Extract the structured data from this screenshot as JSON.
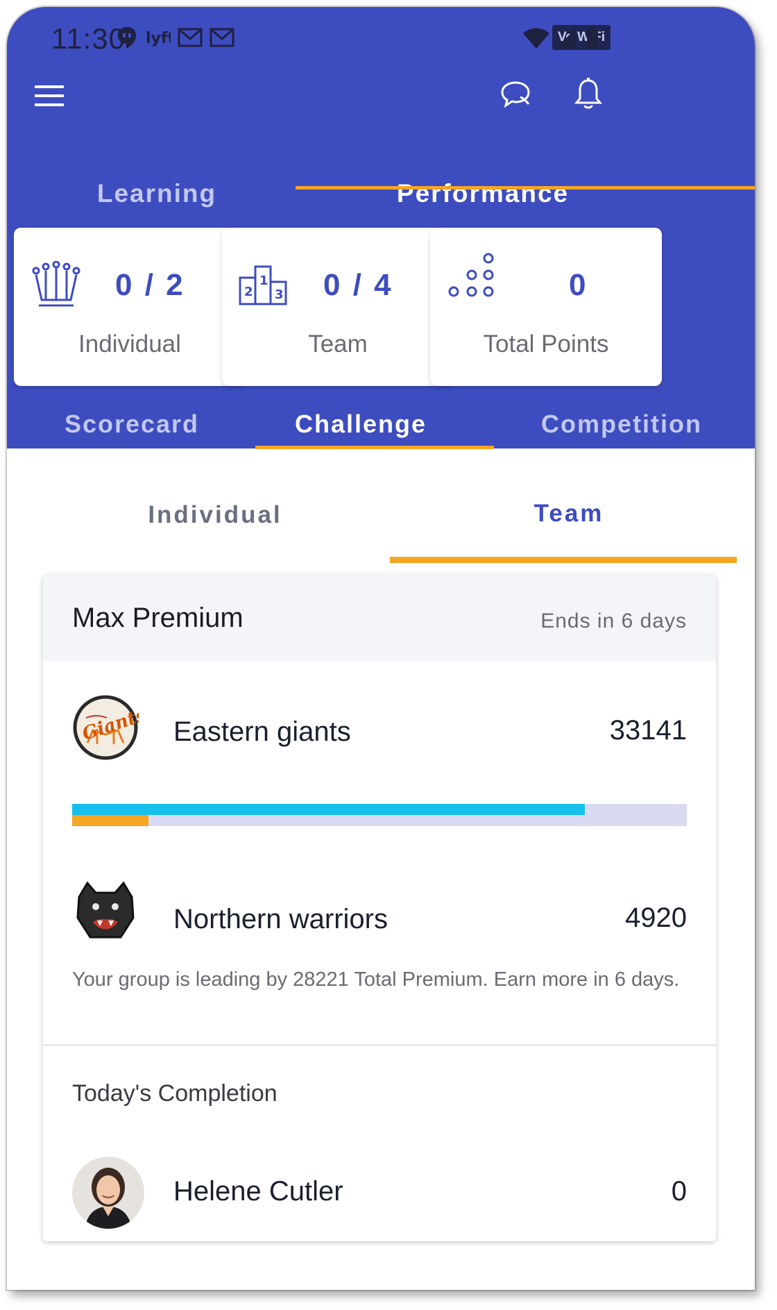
{
  "status_bar": {
    "time": "11:30",
    "vowifi": "Vo WiFi",
    "notification_icons": [
      "hangouts-icon",
      "lyft-icon",
      "mail-icon",
      "mail-icon"
    ],
    "system_icons": [
      "wifi-icon",
      "signal-icon",
      "battery-icon"
    ]
  },
  "app_bar": {
    "menu_icon": "menu-icon",
    "chat_icon": "chat-icon",
    "bell_icon": "bell-icon"
  },
  "top_tabs": [
    {
      "label": "Learning",
      "active": false
    },
    {
      "label": "Performance",
      "active": true
    }
  ],
  "stats": [
    {
      "value": "0 / 2",
      "label": "Individual",
      "icon": "crown-icon"
    },
    {
      "value": "0 / 4",
      "label": "Team",
      "icon": "podium-icon"
    },
    {
      "value": "0",
      "label": "Total Points",
      "icon": "dots-pyramid-icon"
    }
  ],
  "sub_tabs": [
    {
      "label": "Scorecard",
      "active": false
    },
    {
      "label": "Challenge",
      "active": true
    },
    {
      "label": "Competition",
      "active": false
    }
  ],
  "challenge_tabs": [
    {
      "label": "Individual",
      "active": false
    },
    {
      "label": "Team",
      "active": true
    }
  ],
  "challenge": {
    "title": "Max Premium",
    "ends": "Ends in 6 days",
    "teams": [
      {
        "name": "Eastern giants",
        "score": "33141",
        "logo": "giants-logo"
      },
      {
        "name": "Northern warriors",
        "score": "4920",
        "logo": "panther-logo"
      }
    ],
    "progress": {
      "team1_fraction": 0.834,
      "team2_fraction": 0.124
    },
    "message": "Your group is leading by 28221 Total Premium. Earn more in 6 days.",
    "completion_title": "Today's Completion",
    "completion": [
      {
        "name": "Helene Cutler",
        "score": "0"
      }
    ]
  },
  "colors": {
    "primary": "#3d4cbf",
    "accent": "#f5a623",
    "progress_team1": "#16c0ec",
    "progress_track": "#d9dbf2"
  }
}
